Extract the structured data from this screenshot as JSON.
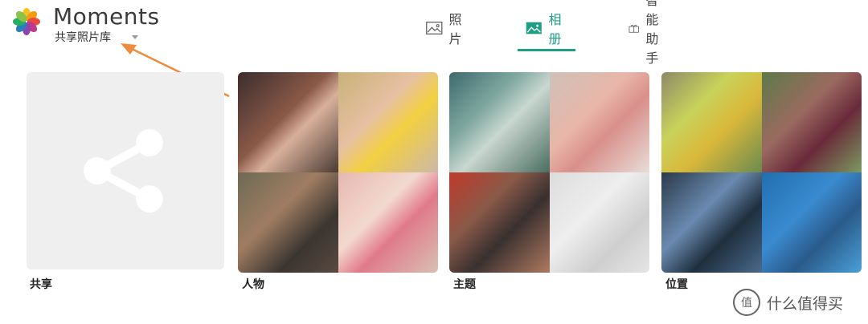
{
  "header": {
    "app_title": "Moments",
    "library_name": "共享照片库"
  },
  "tabs": [
    {
      "label": "照片",
      "icon": "image-icon",
      "active": false
    },
    {
      "label": "相册",
      "icon": "album-icon",
      "active": true
    },
    {
      "label": "智能助手",
      "icon": "gift-icon",
      "active": false
    }
  ],
  "albums": [
    {
      "label": "共享",
      "icon": "share-icon"
    },
    {
      "label": "人物"
    },
    {
      "label": "主题"
    },
    {
      "label": "位置"
    }
  ],
  "watermark": {
    "text": "什么值得买",
    "glyph": "值"
  },
  "colors": {
    "accent": "#1f9e86",
    "annotation_arrow": "#f08a3c",
    "share_tile_bg": "#efefef"
  }
}
